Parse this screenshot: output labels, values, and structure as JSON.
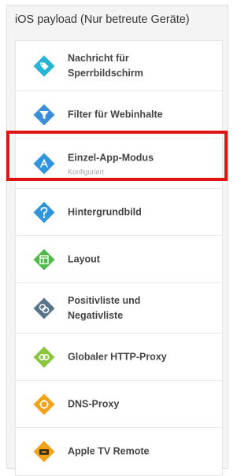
{
  "panel": {
    "title": "iOS payload (Nur betreute Geräte)"
  },
  "items": [
    {
      "label_lines": [
        "Nachricht für",
        "Sperrbildschirm"
      ],
      "icon": "tag-icon",
      "color": "#23b5d3"
    },
    {
      "label_lines": [
        "Filter für Webinhalte"
      ],
      "icon": "funnel-filter-icon",
      "color": "#3b8fd8"
    },
    {
      "label_lines": [
        "Einzel-App-Modus"
      ],
      "status": "Konfiguriert",
      "icon": "app-store-icon",
      "color": "#2f96dd"
    },
    {
      "label_lines": [
        "Hintergrundbild"
      ],
      "icon": "wallpaper-icon",
      "color": "#2f96dd"
    },
    {
      "label_lines": [
        "Layout"
      ],
      "icon": "layout-icon",
      "color": "#4dba4a"
    },
    {
      "label_lines": [
        "Positivliste und",
        "Negativliste"
      ],
      "icon": "allow-deny-list-icon",
      "color": "#58738c"
    },
    {
      "label_lines": [
        "Globaler HTTP-Proxy"
      ],
      "icon": "http-proxy-icon",
      "color": "#8cc63f"
    },
    {
      "label_lines": [
        "DNS-Proxy"
      ],
      "icon": "dns-proxy-icon",
      "color": "#f2a31a"
    },
    {
      "label_lines": [
        "Apple TV Remote"
      ],
      "icon": "apple-tv-remote-icon",
      "color": "#f2a31a"
    }
  ],
  "highlight": {
    "color": "#e11414",
    "item_index": 2
  }
}
